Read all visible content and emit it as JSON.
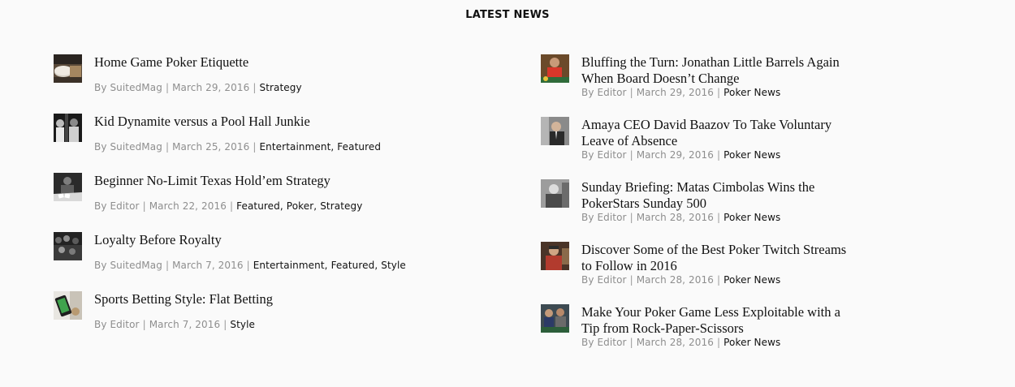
{
  "section": {
    "title": "LATEST NEWS"
  },
  "left": [
    {
      "title": "Home Game Poker Etiquette",
      "author": "By SuitedMag",
      "date": "March 29, 2016",
      "categories": [
        "Strategy"
      ],
      "thumb": "poker-chips-thumb"
    },
    {
      "title": "Kid Dynamite versus a Pool Hall Junkie",
      "author": "By SuitedMag",
      "date": "March 25, 2016",
      "categories": [
        "Entertainment",
        "Featured"
      ],
      "thumb": "movie-still-thumb"
    },
    {
      "title": "Beginner No-Limit Texas Hold’em Strategy",
      "author": "By Editor",
      "date": "March 22, 2016",
      "categories": [
        "Featured",
        "Poker",
        "Strategy"
      ],
      "thumb": "poker-table-thumb"
    },
    {
      "title": "Loyalty Before Royalty",
      "author": "By SuitedMag",
      "date": "March 7, 2016",
      "categories": [
        "Entertainment",
        "Featured",
        "Style"
      ],
      "thumb": "crowd-thumb"
    },
    {
      "title": "Sports Betting Style: Flat Betting",
      "author": "By Editor",
      "date": "March 7, 2016",
      "categories": [
        "Style"
      ],
      "thumb": "phone-betting-thumb"
    }
  ],
  "right": [
    {
      "title_line1": "Bluffing the Turn: Jonathan Little Barrels Again",
      "title_line2": "When Board Doesn’t Change",
      "author": "By Editor",
      "date": "March 29, 2016",
      "category": "Poker News",
      "thumb": "poker-player-red-thumb"
    },
    {
      "title_line1": "Amaya CEO David Baazov To Take Voluntary",
      "title_line2": "Leave of Absence",
      "author": "By Editor",
      "date": "March 29, 2016",
      "category": "Poker News",
      "thumb": "ceo-portrait-thumb"
    },
    {
      "title_line1": "Sunday Briefing: Matas Cimbolas Wins the",
      "title_line2": "PokerStars Sunday 500",
      "author": "By Editor",
      "date": "March 28, 2016",
      "category": "Poker News",
      "thumb": "player-bw-thumb"
    },
    {
      "title_line1": "Discover Some of the Best Poker Twitch Streams",
      "title_line2": "to Follow in 2016",
      "author": "By Editor",
      "date": "March 28, 2016",
      "category": "Poker News",
      "thumb": "streamer-thumb"
    },
    {
      "title_line1": "Make Your Poker Game Less Exploitable with a",
      "title_line2": "Tip from Rock-Paper-Scissors",
      "author": "By Editor",
      "date": "March 28, 2016",
      "category": "Poker News",
      "thumb": "poker-players-thumb"
    }
  ],
  "colors": {
    "text": "#111111",
    "meta": "#8e8e8e",
    "background": "#fafafa"
  }
}
